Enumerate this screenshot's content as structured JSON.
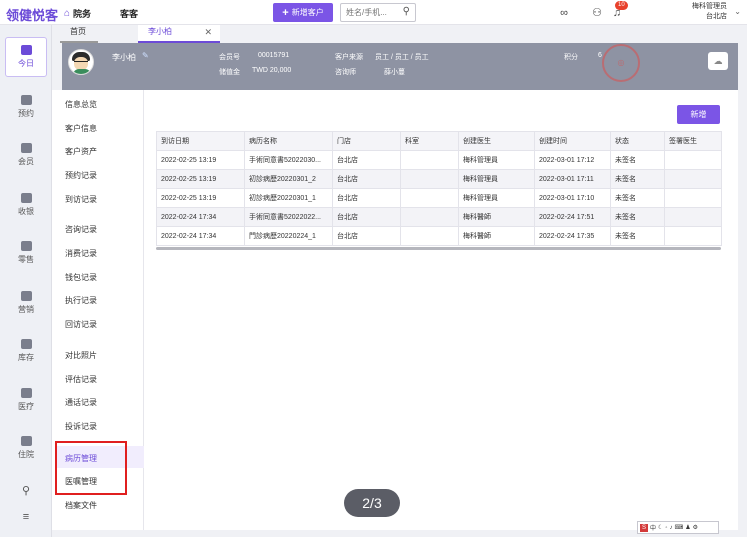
{
  "brand": {
    "name": "领健悦客"
  },
  "topnav": {
    "home_label": "院务",
    "customer_label": "客客"
  },
  "new_customer": {
    "label": "新增客户"
  },
  "search": {
    "placeholder": "姓名/手机..."
  },
  "notifications": {
    "count": "10"
  },
  "user": {
    "name": "梅科管理员",
    "store": "台北店"
  },
  "sidebar": {
    "items": [
      {
        "label": "今日",
        "active": true
      },
      {
        "label": "预约"
      },
      {
        "label": "会员"
      },
      {
        "label": "收银"
      },
      {
        "label": "零售"
      },
      {
        "label": "营销"
      },
      {
        "label": "库存"
      },
      {
        "label": "医疗"
      },
      {
        "label": "住院"
      }
    ]
  },
  "tabs": {
    "home": "首页",
    "patient": "李小柏"
  },
  "patient": {
    "name": "李小柏",
    "member_no_label": "会员号",
    "member_no": "00015791",
    "balance_label": "储值金",
    "balance": "TWD 20,000",
    "source_label": "客户来源",
    "source": "员工 / 员工 / 员工",
    "consultant_label": "咨询师",
    "consultant": "薛小蔓",
    "points_label": "积分",
    "points": "6"
  },
  "subnav": {
    "items": [
      "信息总览",
      "客户信息",
      "客户资产",
      "预约记录",
      "到访记录",
      "咨询记录",
      "消费记录",
      "钱包记录",
      "执行记录",
      "回访记录",
      "对比照片",
      "评估记录",
      "通话记录",
      "投诉记录",
      "病历管理",
      "医嘱管理",
      "档案文件"
    ]
  },
  "add_button": {
    "label": "新增"
  },
  "table": {
    "headers": [
      "到访日期",
      "病历名称",
      "门店",
      "科室",
      "创建医生",
      "创建时间",
      "状态",
      "签署医生"
    ],
    "rows": [
      [
        "2022-02-25 13:19",
        "手術同意書52022030...",
        "台北店",
        "",
        "梅科管理員",
        "2022-03-01 17:12",
        "未签名",
        ""
      ],
      [
        "2022-02-25 13:19",
        "初診病歷20220301_2",
        "台北店",
        "",
        "梅科管理員",
        "2022-03-01 17:11",
        "未签名",
        ""
      ],
      [
        "2022-02-25 13:19",
        "初診病歷20220301_1",
        "台北店",
        "",
        "梅科管理員",
        "2022-03-01 17:10",
        "未签名",
        ""
      ],
      [
        "2022-02-24 17:34",
        "手術同意書52022022...",
        "台北店",
        "",
        "梅科醫師",
        "2022-02-24 17:51",
        "未签名",
        ""
      ],
      [
        "2022-02-24 17:34",
        "門診病歷20220224_1",
        "台北店",
        "",
        "梅科醫師",
        "2022-02-24 17:35",
        "未签名",
        ""
      ]
    ]
  },
  "page_indicator": {
    "text": "2/3"
  },
  "ime": {
    "label": "中"
  }
}
